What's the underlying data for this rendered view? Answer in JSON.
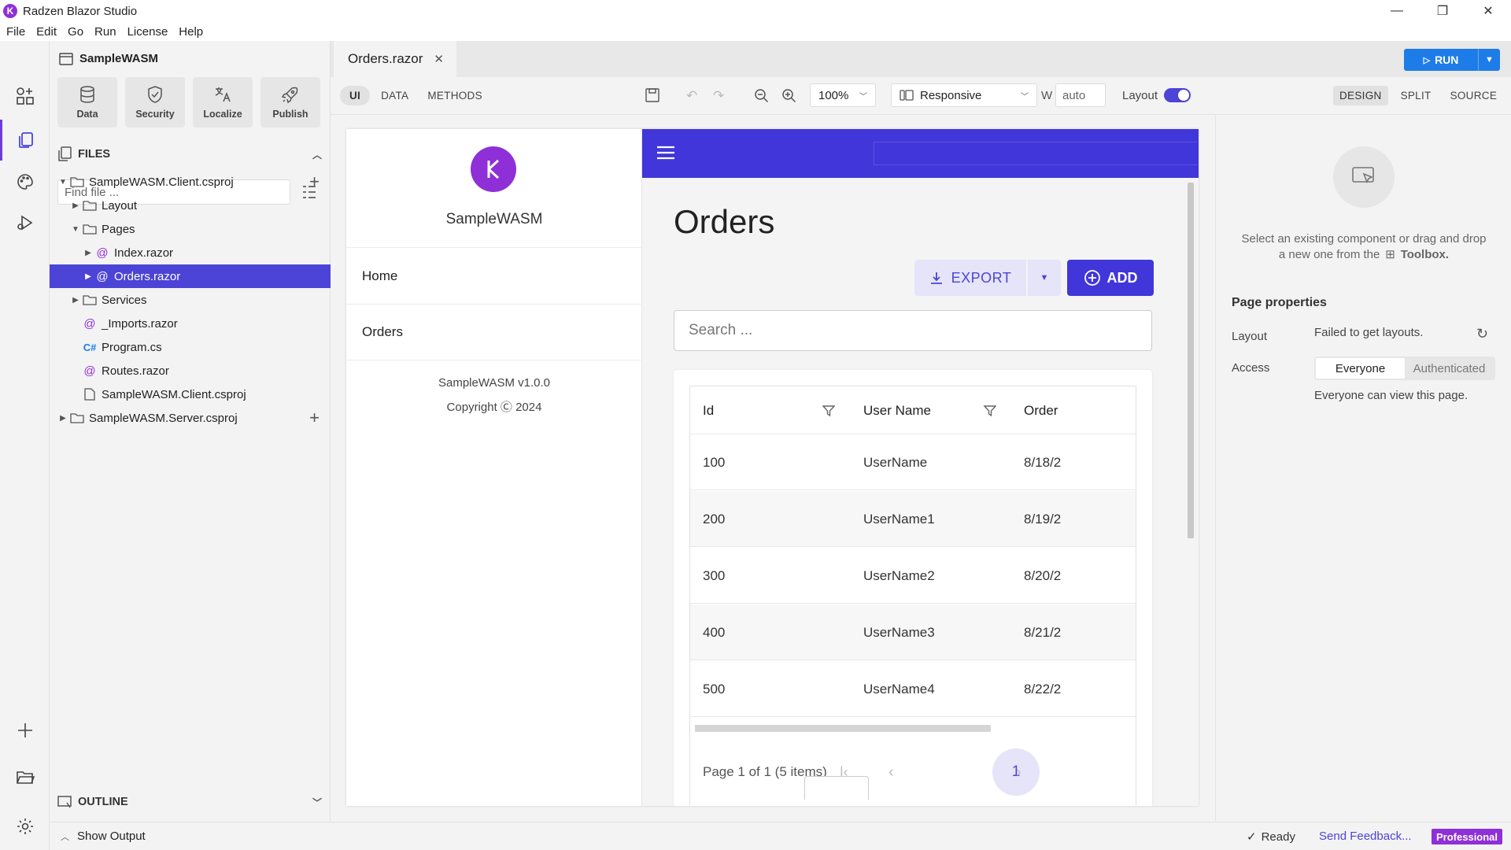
{
  "window": {
    "title": "Radzen Blazor Studio",
    "controls": [
      "—",
      "❐",
      "✕"
    ]
  },
  "menu": [
    "File",
    "Edit",
    "Go",
    "Run",
    "License",
    "Help"
  ],
  "project": {
    "name": "SampleWASM",
    "tiles": [
      {
        "label": "Data",
        "icon": "database-icon"
      },
      {
        "label": "Security",
        "icon": "shield-icon"
      },
      {
        "label": "Localize",
        "icon": "translate-icon"
      },
      {
        "label": "Publish",
        "icon": "rocket-icon"
      }
    ]
  },
  "files": {
    "header": "FILES",
    "find_placeholder": "Find file ...",
    "tree": [
      {
        "label": "SampleWASM.Client.csproj",
        "type": "folder",
        "level": 0,
        "expanded": true,
        "add": true
      },
      {
        "label": "Layout",
        "type": "folder",
        "level": 1,
        "expanded": false
      },
      {
        "label": "Pages",
        "type": "folder",
        "level": 1,
        "expanded": true
      },
      {
        "label": "Index.razor",
        "type": "razor",
        "level": 2,
        "expanded": false
      },
      {
        "label": "Orders.razor",
        "type": "razor",
        "level": 2,
        "expanded": false,
        "selected": true
      },
      {
        "label": "Services",
        "type": "folder",
        "level": 1,
        "expanded": false
      },
      {
        "label": "_Imports.razor",
        "type": "razor",
        "level": 1
      },
      {
        "label": "Program.cs",
        "type": "cs",
        "level": 1
      },
      {
        "label": "Routes.razor",
        "type": "razor",
        "level": 1
      },
      {
        "label": "SampleWASM.Client.csproj",
        "type": "file",
        "level": 1
      },
      {
        "label": "SampleWASM.Server.csproj",
        "type": "folder",
        "level": 0,
        "expanded": false,
        "add": true
      }
    ]
  },
  "outline": {
    "header": "OUTLINE"
  },
  "status": {
    "show_output": "Show Output",
    "ready": "Ready",
    "feedback": "Send Feedback...",
    "edition": "Professional"
  },
  "editor": {
    "tab": "Orders.razor",
    "run_label": "RUN",
    "modes": [
      "UI",
      "DATA",
      "METHODS"
    ],
    "zoom": "100%",
    "responsive": "Responsive",
    "width_label": "W",
    "width_value": "auto",
    "layout_label": "Layout",
    "views": [
      "DESIGN",
      "SPLIT",
      "SOURCE"
    ]
  },
  "app": {
    "name": "SampleWASM",
    "nav": [
      "Home",
      "Orders"
    ],
    "version": "SampleWASM v1.0.0",
    "copyright": "Copyright Ⓒ 2024",
    "page_title": "Orders",
    "export_label": "EXPORT",
    "add_label": "ADD",
    "search_placeholder": "Search ...",
    "columns": [
      "Id",
      "User Name",
      "Order"
    ],
    "rows": [
      [
        "100",
        "UserName",
        "8/18/2"
      ],
      [
        "200",
        "UserName1",
        "8/19/2"
      ],
      [
        "300",
        "UserName2",
        "8/20/2"
      ],
      [
        "400",
        "UserName3",
        "8/21/2"
      ],
      [
        "500",
        "UserName4",
        "8/22/2"
      ]
    ],
    "pager_summary": "Page 1 of 1 (5 items)",
    "current_page": "1"
  },
  "properties": {
    "hint_line1": "Select an existing component or drag and drop",
    "hint_line2_pre": "a new one from the",
    "hint_toolbox": "Toolbox.",
    "section_title": "Page properties",
    "layout_label": "Layout",
    "layout_value": "Failed to get layouts.",
    "access_label": "Access",
    "access_options": [
      "Everyone",
      "Authenticated"
    ],
    "access_selected": "Everyone",
    "access_note": "Everyone can view this page."
  },
  "colors": {
    "accent": "#4c44d6",
    "header": "#4136d9",
    "run": "#1e7ce8",
    "brand": "#8f2fd8"
  }
}
